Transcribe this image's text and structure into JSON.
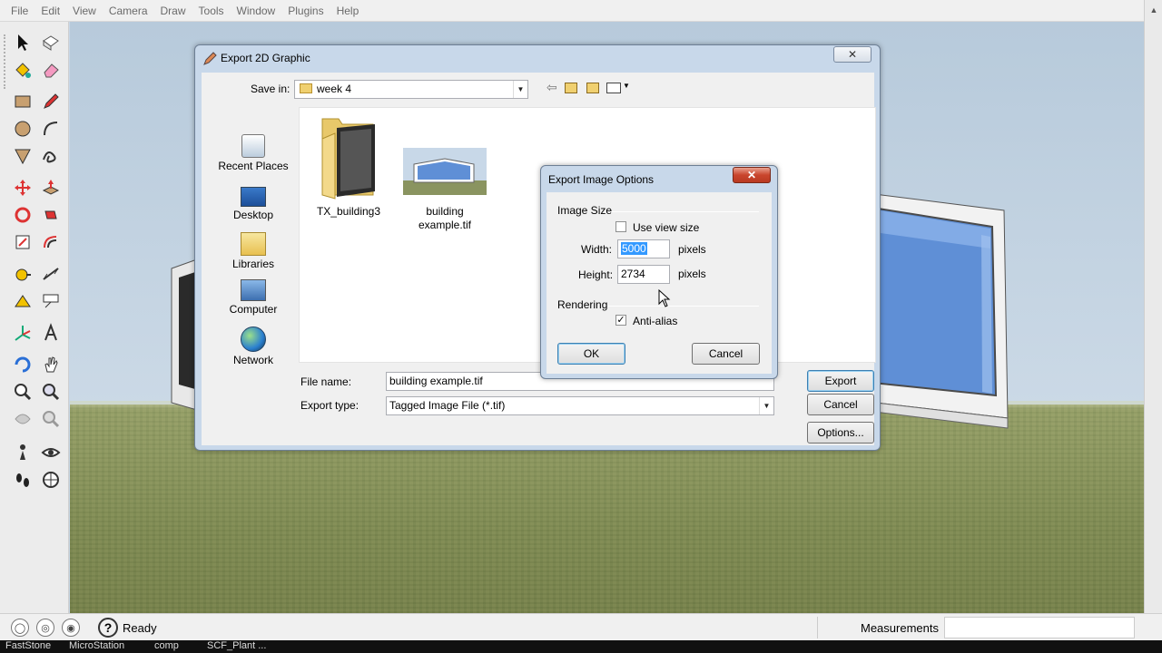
{
  "menu": [
    "File",
    "Edit",
    "View",
    "Camera",
    "Draw",
    "Tools",
    "Window",
    "Plugins",
    "Help"
  ],
  "export_dialog": {
    "title": "Export 2D Graphic",
    "close_label": "✕",
    "save_in_label": "Save in:",
    "save_in_value": "week 4",
    "places": [
      "Recent Places",
      "Desktop",
      "Libraries",
      "Computer",
      "Network"
    ],
    "files": [
      {
        "name": "TX_building3",
        "icon": "folder-icon"
      },
      {
        "name": "building example.tif",
        "icon": "image-thumbnail-icon"
      }
    ],
    "file_name_label": "File name:",
    "file_name_value": "building example.tif",
    "export_type_label": "Export type:",
    "export_type_value": "Tagged Image File (*.tif)",
    "export_button": "Export",
    "cancel_button": "Cancel",
    "options_button": "Options..."
  },
  "options_dialog": {
    "title": "Export Image Options",
    "close_label": "✕",
    "image_size_group": "Image Size",
    "use_view_size_label": "Use view size",
    "use_view_size_checked": false,
    "width_label": "Width:",
    "width_value": "5000",
    "height_label": "Height:",
    "height_value": "2734",
    "units_label": "pixels",
    "rendering_group": "Rendering",
    "anti_alias_label": "Anti-alias",
    "anti_alias_checked": true,
    "ok_button": "OK",
    "cancel_button": "Cancel"
  },
  "status": {
    "ready": "Ready",
    "help_icon": "?",
    "measurements_label": "Measurements"
  },
  "taskbar": [
    "FastStone",
    "MicroStation",
    "comp",
    "SCF_Plant ..."
  ],
  "colors": {
    "glass": "#6f9fe0",
    "grass": "#8a9460",
    "sky": "#c3d3e2",
    "dialog_frame": "#c8d8ea",
    "close_red": "#c9452d"
  }
}
